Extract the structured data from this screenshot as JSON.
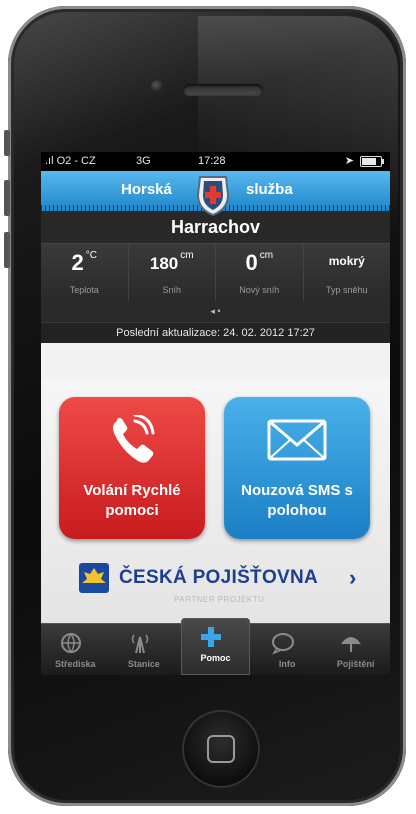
{
  "statusbar": {
    "carrier": ".ıl O2 - CZ",
    "network": "3G",
    "time": "17:28"
  },
  "banner": {
    "left": "Horská",
    "right": "služba"
  },
  "location": "Harrachov",
  "stats": [
    {
      "value": "2",
      "unit": "°C",
      "label": "Teplota"
    },
    {
      "value": "180",
      "unit": "cm",
      "label": "Sníh"
    },
    {
      "value": "0",
      "unit": "cm",
      "label": "Nový sníh"
    },
    {
      "value": "mokrý",
      "unit": "",
      "label": "Typ sněhu"
    }
  ],
  "last_update": "Poslední aktualizace: 24. 02. 2012 17:27",
  "actions": {
    "call": {
      "line1": "Volání Rychlé",
      "line2": "pomoci",
      "icon": "phone-icon",
      "color": "#d62a2b"
    },
    "sms": {
      "line1": "Nouzová SMS s",
      "line2": "polohou",
      "icon": "envelope-icon",
      "color": "#2a8fd3"
    }
  },
  "partner": {
    "name": "ČESKÁ POJIŠŤOVNA",
    "subtitle": "PARTNER PROJEKTU"
  },
  "tabs": [
    {
      "label": "Střediska",
      "icon": "globe-icon"
    },
    {
      "label": "Stanice",
      "icon": "antenna-icon"
    },
    {
      "label": "Pomoc",
      "icon": "plus-icon",
      "active": true
    },
    {
      "label": "Info",
      "icon": "speech-bubble-icon"
    },
    {
      "label": "Pojištění",
      "icon": "umbrella-icon"
    }
  ]
}
